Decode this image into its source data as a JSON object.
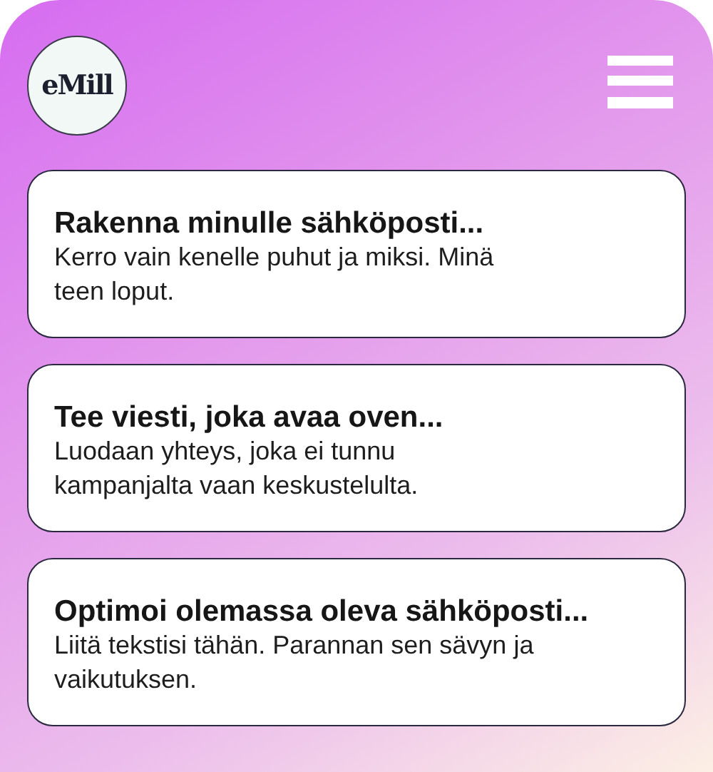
{
  "logo": {
    "text": "eMill"
  },
  "cards": [
    {
      "title": "Rakenna minulle sähköposti...",
      "description": "Kerro vain kenelle puhut ja miksi. Minä teen loput."
    },
    {
      "title": "Tee viesti, joka avaa oven...",
      "description": "Luodaan yhteys, joka ei tunnu kampanjalta vaan keskustelulta."
    },
    {
      "title": "Optimoi olemassa oleva sähköposti...",
      "description": "Liitä tekstisi tähän. Parannan sen sävyn ja vaikutuksen."
    }
  ]
}
